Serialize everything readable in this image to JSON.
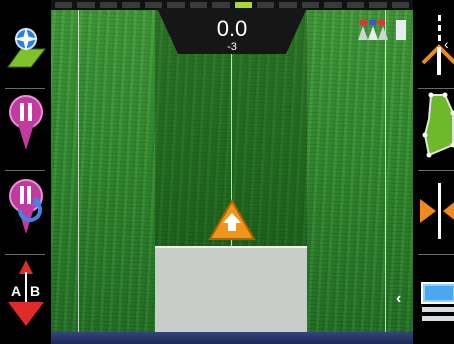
{
  "guidance": {
    "offset_value": "0.0",
    "offset_sub": "-3",
    "progress_segments": [
      false,
      false,
      false,
      false,
      false,
      false,
      false,
      false,
      true,
      false,
      false,
      false,
      false,
      false,
      false,
      false
    ]
  },
  "left_toolbar": {
    "ab_label_a": "A",
    "ab_label_b": "B"
  },
  "icons": {
    "map_view": "map-pin-icon",
    "pause": "pause-pin-icon",
    "pause_return": "pause-return-icon",
    "ab_line": "ab-line-icon",
    "guidance_steer": "steer-icon",
    "field_boundary": "boundary-icon",
    "nudge": "nudge-icon",
    "screen_toggle": "screen-icon"
  },
  "colors": {
    "accent_green": "#a9d82f",
    "pin_magenta": "#c13aa0",
    "tractor_orange": "#f0951c",
    "nudge_orange": "#f08a1e"
  }
}
